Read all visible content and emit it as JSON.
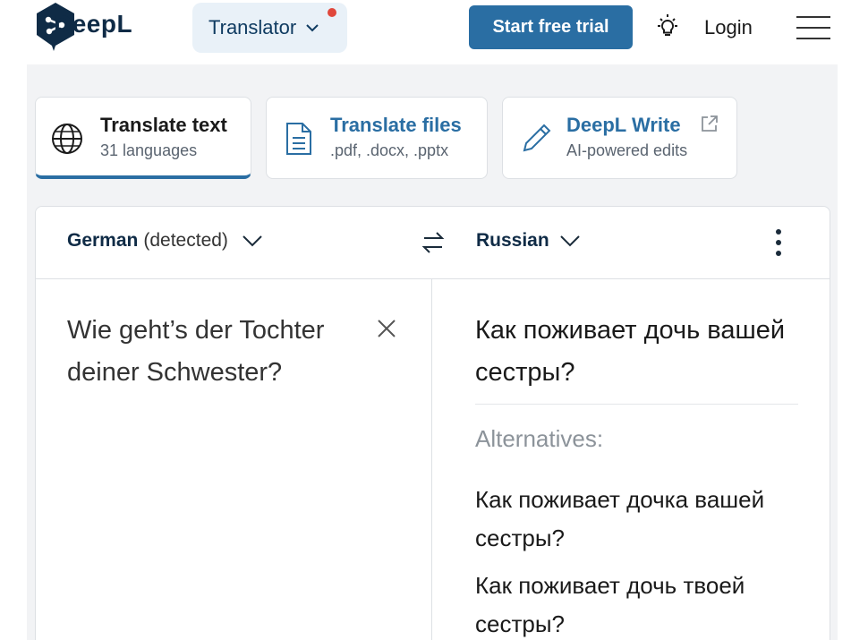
{
  "header": {
    "brand": "DeepL",
    "translator_menu": "Translator",
    "trial_button": "Start free trial",
    "login": "Login",
    "icons": [
      "deepl-logo-icon",
      "chevron-down-icon",
      "lightbulb-icon",
      "hamburger-menu-icon"
    ],
    "accent_color": "#2a6ea3",
    "notification_dot_color": "#e0473b"
  },
  "tabs": [
    {
      "title": "Translate text",
      "subtitle": "31 languages",
      "icon": "globe-icon",
      "active": true
    },
    {
      "title": "Translate files",
      "subtitle": ".pdf, .docx, .pptx",
      "icon": "document-icon",
      "active": false
    },
    {
      "title": "DeepL Write",
      "subtitle": "AI-powered edits",
      "icon": "pencil-icon",
      "external": true,
      "active": false
    }
  ],
  "translator": {
    "source_language": "German",
    "source_detected": "(detected)",
    "target_language": "Russian",
    "source_text": "Wie geht’s der Tochter deiner Schwester?",
    "target_text": "Как поживает дочь вашей сестры?",
    "alternatives_label": "Alternatives:",
    "alternatives": [
      "Как поживает дочка вашей сестры?",
      "Как поживает дочь твоей сестры?"
    ]
  }
}
